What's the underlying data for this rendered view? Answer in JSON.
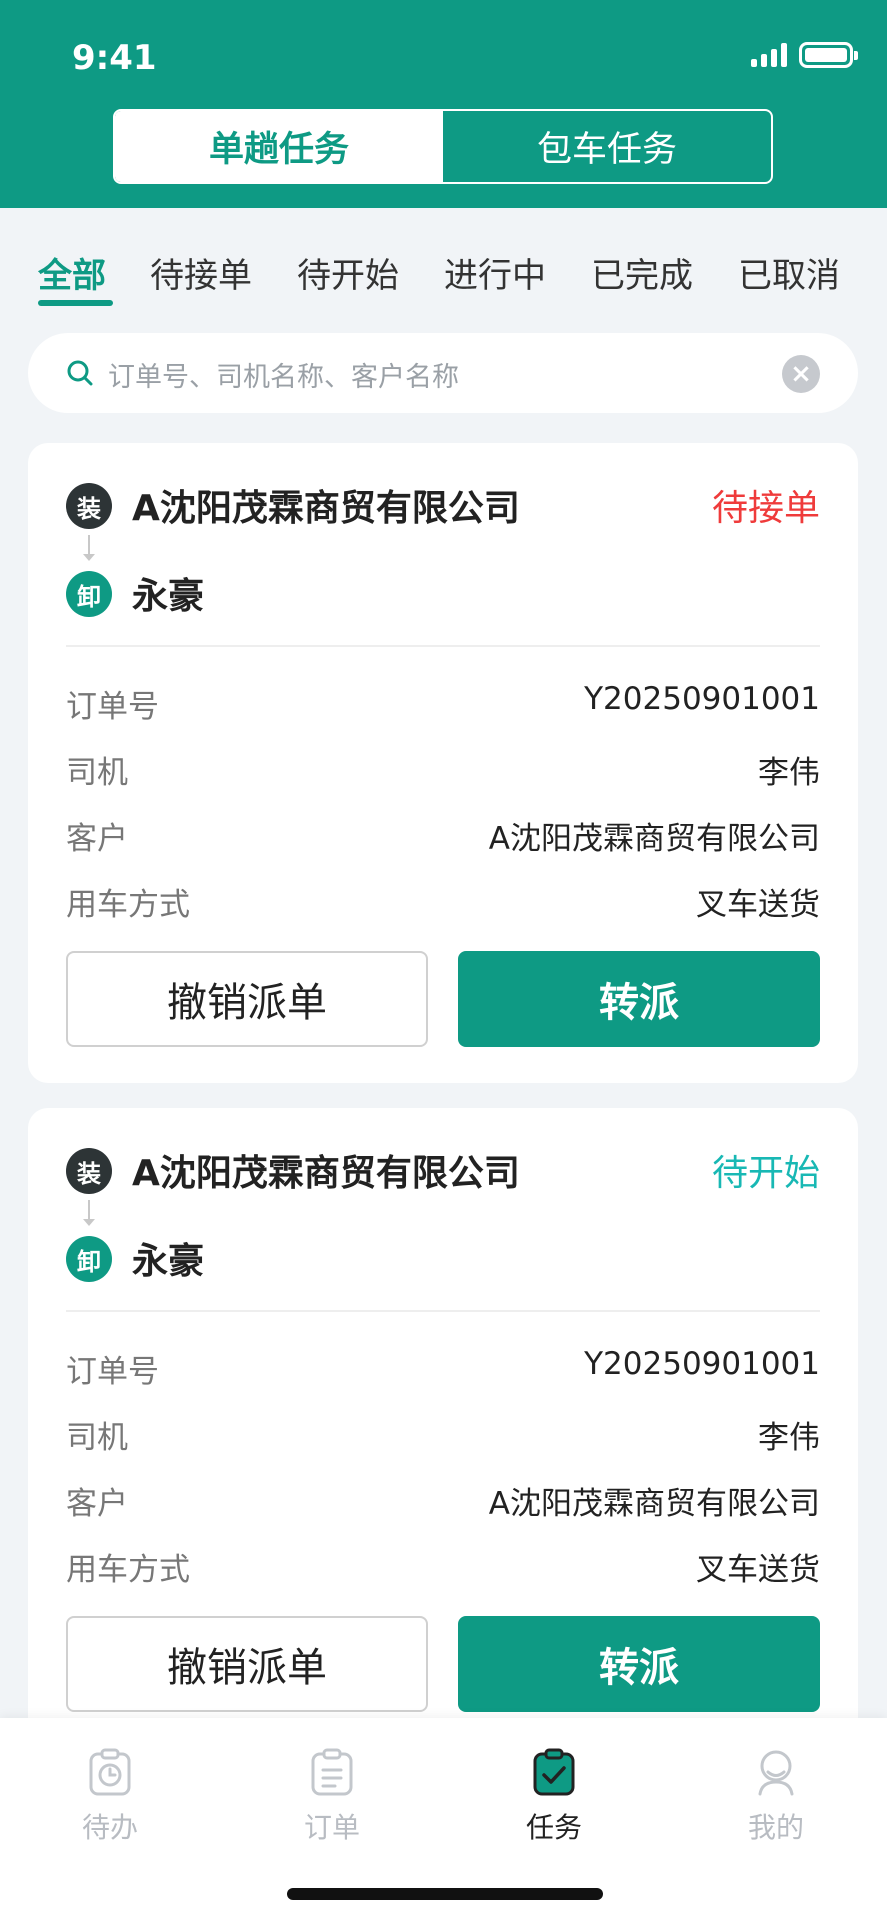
{
  "status_bar": {
    "time": "9:41"
  },
  "segment": {
    "single": "单趟任务",
    "charter": "包车任务"
  },
  "status_tabs": [
    "全部",
    "待接单",
    "待开始",
    "进行中",
    "已完成",
    "已取消"
  ],
  "search": {
    "placeholder": "订单号、司机名称、客户名称",
    "clear": "×"
  },
  "badges": {
    "load": "装",
    "unload": "卸"
  },
  "field_labels": {
    "order_no": "订单号",
    "driver": "司机",
    "customer": "客户",
    "vehicle_mode": "用车方式"
  },
  "cards": [
    {
      "from": "A沈阳茂霖商贸有限公司",
      "to": "永豪",
      "status": "待接单",
      "status_color": "#ef3b3b",
      "order_no": "Y20250901001",
      "driver": "李伟",
      "customer": "A沈阳茂霖商贸有限公司",
      "vehicle_mode": "叉车送货",
      "cancel_label": "撤销派单",
      "transfer_label": "转派"
    },
    {
      "from": "A沈阳茂霖商贸有限公司",
      "to": "永豪",
      "status": "待开始",
      "status_color": "#18b8b4",
      "order_no": "Y20250901001",
      "driver": "李伟",
      "customer": "A沈阳茂霖商贸有限公司",
      "vehicle_mode": "叉车送货",
      "cancel_label": "撤销派单",
      "transfer_label": "转派"
    }
  ],
  "tabbar": [
    {
      "label": "待办",
      "icon": "clock-clipboard-icon"
    },
    {
      "label": "订单",
      "icon": "list-clipboard-icon"
    },
    {
      "label": "任务",
      "icon": "check-clipboard-icon"
    },
    {
      "label": "我的",
      "icon": "user-icon"
    }
  ],
  "colors": {
    "brand": "#0e9a84",
    "pending": "#ef3b3b",
    "not_started": "#18b8b4"
  }
}
